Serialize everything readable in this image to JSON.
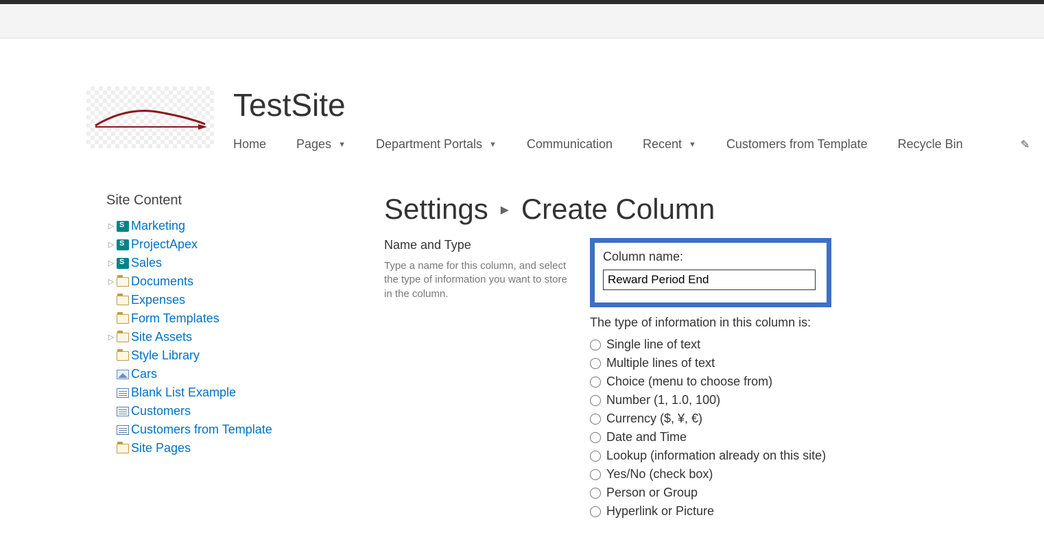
{
  "site": {
    "title": "TestSite"
  },
  "topnav": {
    "items": [
      {
        "label": "Home",
        "hasDropdown": false
      },
      {
        "label": "Pages",
        "hasDropdown": true
      },
      {
        "label": "Department Portals",
        "hasDropdown": true
      },
      {
        "label": "Communication",
        "hasDropdown": false
      },
      {
        "label": "Recent",
        "hasDropdown": true
      },
      {
        "label": "Customers from Template",
        "hasDropdown": false
      },
      {
        "label": "Recycle Bin",
        "hasDropdown": false
      }
    ]
  },
  "sidebar": {
    "heading": "Site Content",
    "items": [
      {
        "label": "Marketing",
        "icon": "sp",
        "expandable": true
      },
      {
        "label": "ProjectApex",
        "icon": "sp",
        "expandable": true
      },
      {
        "label": "Sales",
        "icon": "sp",
        "expandable": true
      },
      {
        "label": "Documents",
        "icon": "folder",
        "expandable": true
      },
      {
        "label": "Expenses",
        "icon": "folder",
        "expandable": false
      },
      {
        "label": "Form Templates",
        "icon": "folder",
        "expandable": false
      },
      {
        "label": "Site Assets",
        "icon": "folder",
        "expandable": true
      },
      {
        "label": "Style Library",
        "icon": "folder",
        "expandable": false
      },
      {
        "label": "Cars",
        "icon": "pic",
        "expandable": false
      },
      {
        "label": "Blank List Example",
        "icon": "list",
        "expandable": false
      },
      {
        "label": "Customers",
        "icon": "list",
        "expandable": false
      },
      {
        "label": "Customers from Template",
        "icon": "list",
        "expandable": false
      },
      {
        "label": "Site Pages",
        "icon": "folder",
        "expandable": false
      }
    ]
  },
  "breadcrumb": {
    "parent": "Settings",
    "current": "Create Column"
  },
  "form": {
    "section_title": "Name and Type",
    "section_desc": "Type a name for this column, and select the type of information you want to store in the column.",
    "column_name_label": "Column name:",
    "column_name_value": "Reward Period End",
    "type_heading": "The type of information in this column is:",
    "type_options": [
      "Single line of text",
      "Multiple lines of text",
      "Choice (menu to choose from)",
      "Number (1, 1.0, 100)",
      "Currency ($, ¥, €)",
      "Date and Time",
      "Lookup (information already on this site)",
      "Yes/No (check box)",
      "Person or Group",
      "Hyperlink or Picture"
    ]
  }
}
